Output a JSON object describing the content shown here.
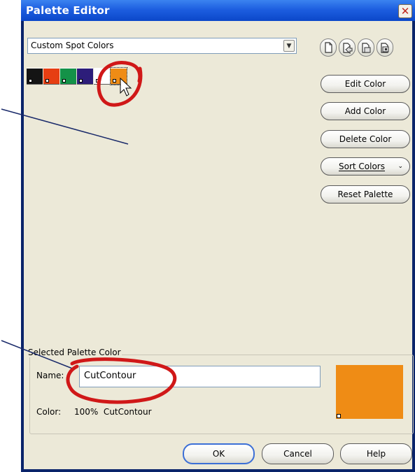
{
  "window": {
    "title": "Palette Editor"
  },
  "palette_select": {
    "value": "Custom Spot Colors"
  },
  "toolbar_icons": [
    "new-palette-icon",
    "open-palette-icon",
    "save-palette-icon",
    "save-as-palette-icon"
  ],
  "swatches": [
    {
      "color": "#141414"
    },
    {
      "color": "#e63e12"
    },
    {
      "color": "#149248"
    },
    {
      "color": "#2d1d7a"
    },
    {
      "color": "#ffffff"
    },
    {
      "color": "#ef8c15"
    }
  ],
  "buttons": {
    "edit": "Edit Color",
    "add": "Add Color",
    "delete": "Delete Color",
    "sort": "Sort Colors",
    "reset": "Reset Palette"
  },
  "selected": {
    "legend": "Selected Palette Color",
    "name_label": "Name:",
    "name_value": "CutContour",
    "color_label": "Color:",
    "color_value": "100%  CutContour",
    "preview_color": "#ef8c15"
  },
  "footer": {
    "ok": "OK",
    "cancel": "Cancel",
    "help": "Help"
  },
  "colors": {
    "titlebar": "#1d5ee0",
    "dialog_bg": "#ece9d8",
    "highlight_circle": "#d01818"
  }
}
